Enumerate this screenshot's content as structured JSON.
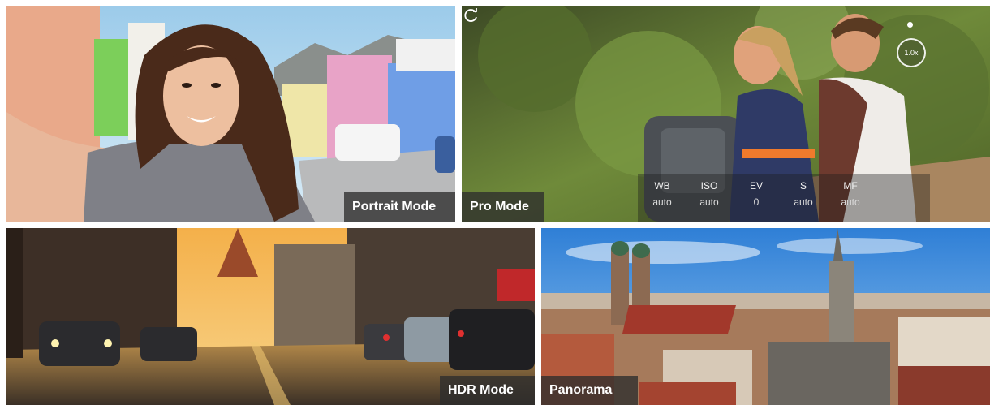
{
  "tiles": {
    "portrait": {
      "label": "Portrait Mode"
    },
    "pro": {
      "label": "Pro Mode",
      "zoom": "1.0x",
      "settings": [
        {
          "key": "WB",
          "value": "auto"
        },
        {
          "key": "ISO",
          "value": "auto"
        },
        {
          "key": "EV",
          "value": "0"
        },
        {
          "key": "S",
          "value": "auto"
        },
        {
          "key": "MF",
          "value": "auto"
        }
      ],
      "reset_icon": "rotate-icon"
    },
    "hdr": {
      "label": "HDR Mode"
    },
    "panorama": {
      "label": "Panorama"
    }
  },
  "colors": {
    "label_background": "#2d2d2d",
    "label_text": "#ffffff"
  }
}
